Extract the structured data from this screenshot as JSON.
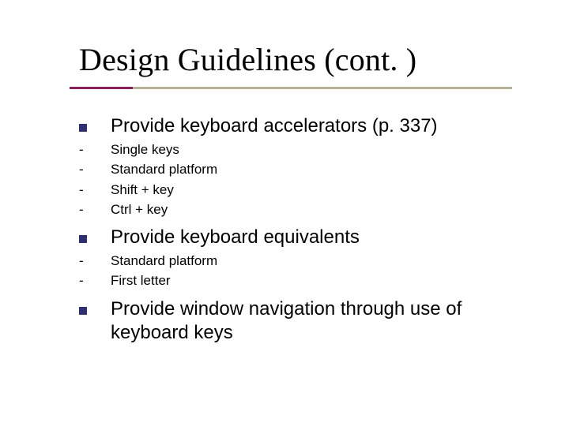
{
  "title": "Design Guidelines (cont. )",
  "items": {
    "p1": {
      "text": "Provide keyboard accelerators (p. 337)"
    },
    "p1s1": {
      "text": "Single keys"
    },
    "p1s2": {
      "text": "Standard platform"
    },
    "p1s3": {
      "text": "Shift + key"
    },
    "p1s4": {
      "text": "Ctrl + key"
    },
    "p2": {
      "text": "Provide keyboard equivalents"
    },
    "p2s1": {
      "text": "Standard platform"
    },
    "p2s2": {
      "text": "First letter"
    },
    "p3": {
      "text": "Provide window navigation through use of keyboard keys"
    }
  }
}
